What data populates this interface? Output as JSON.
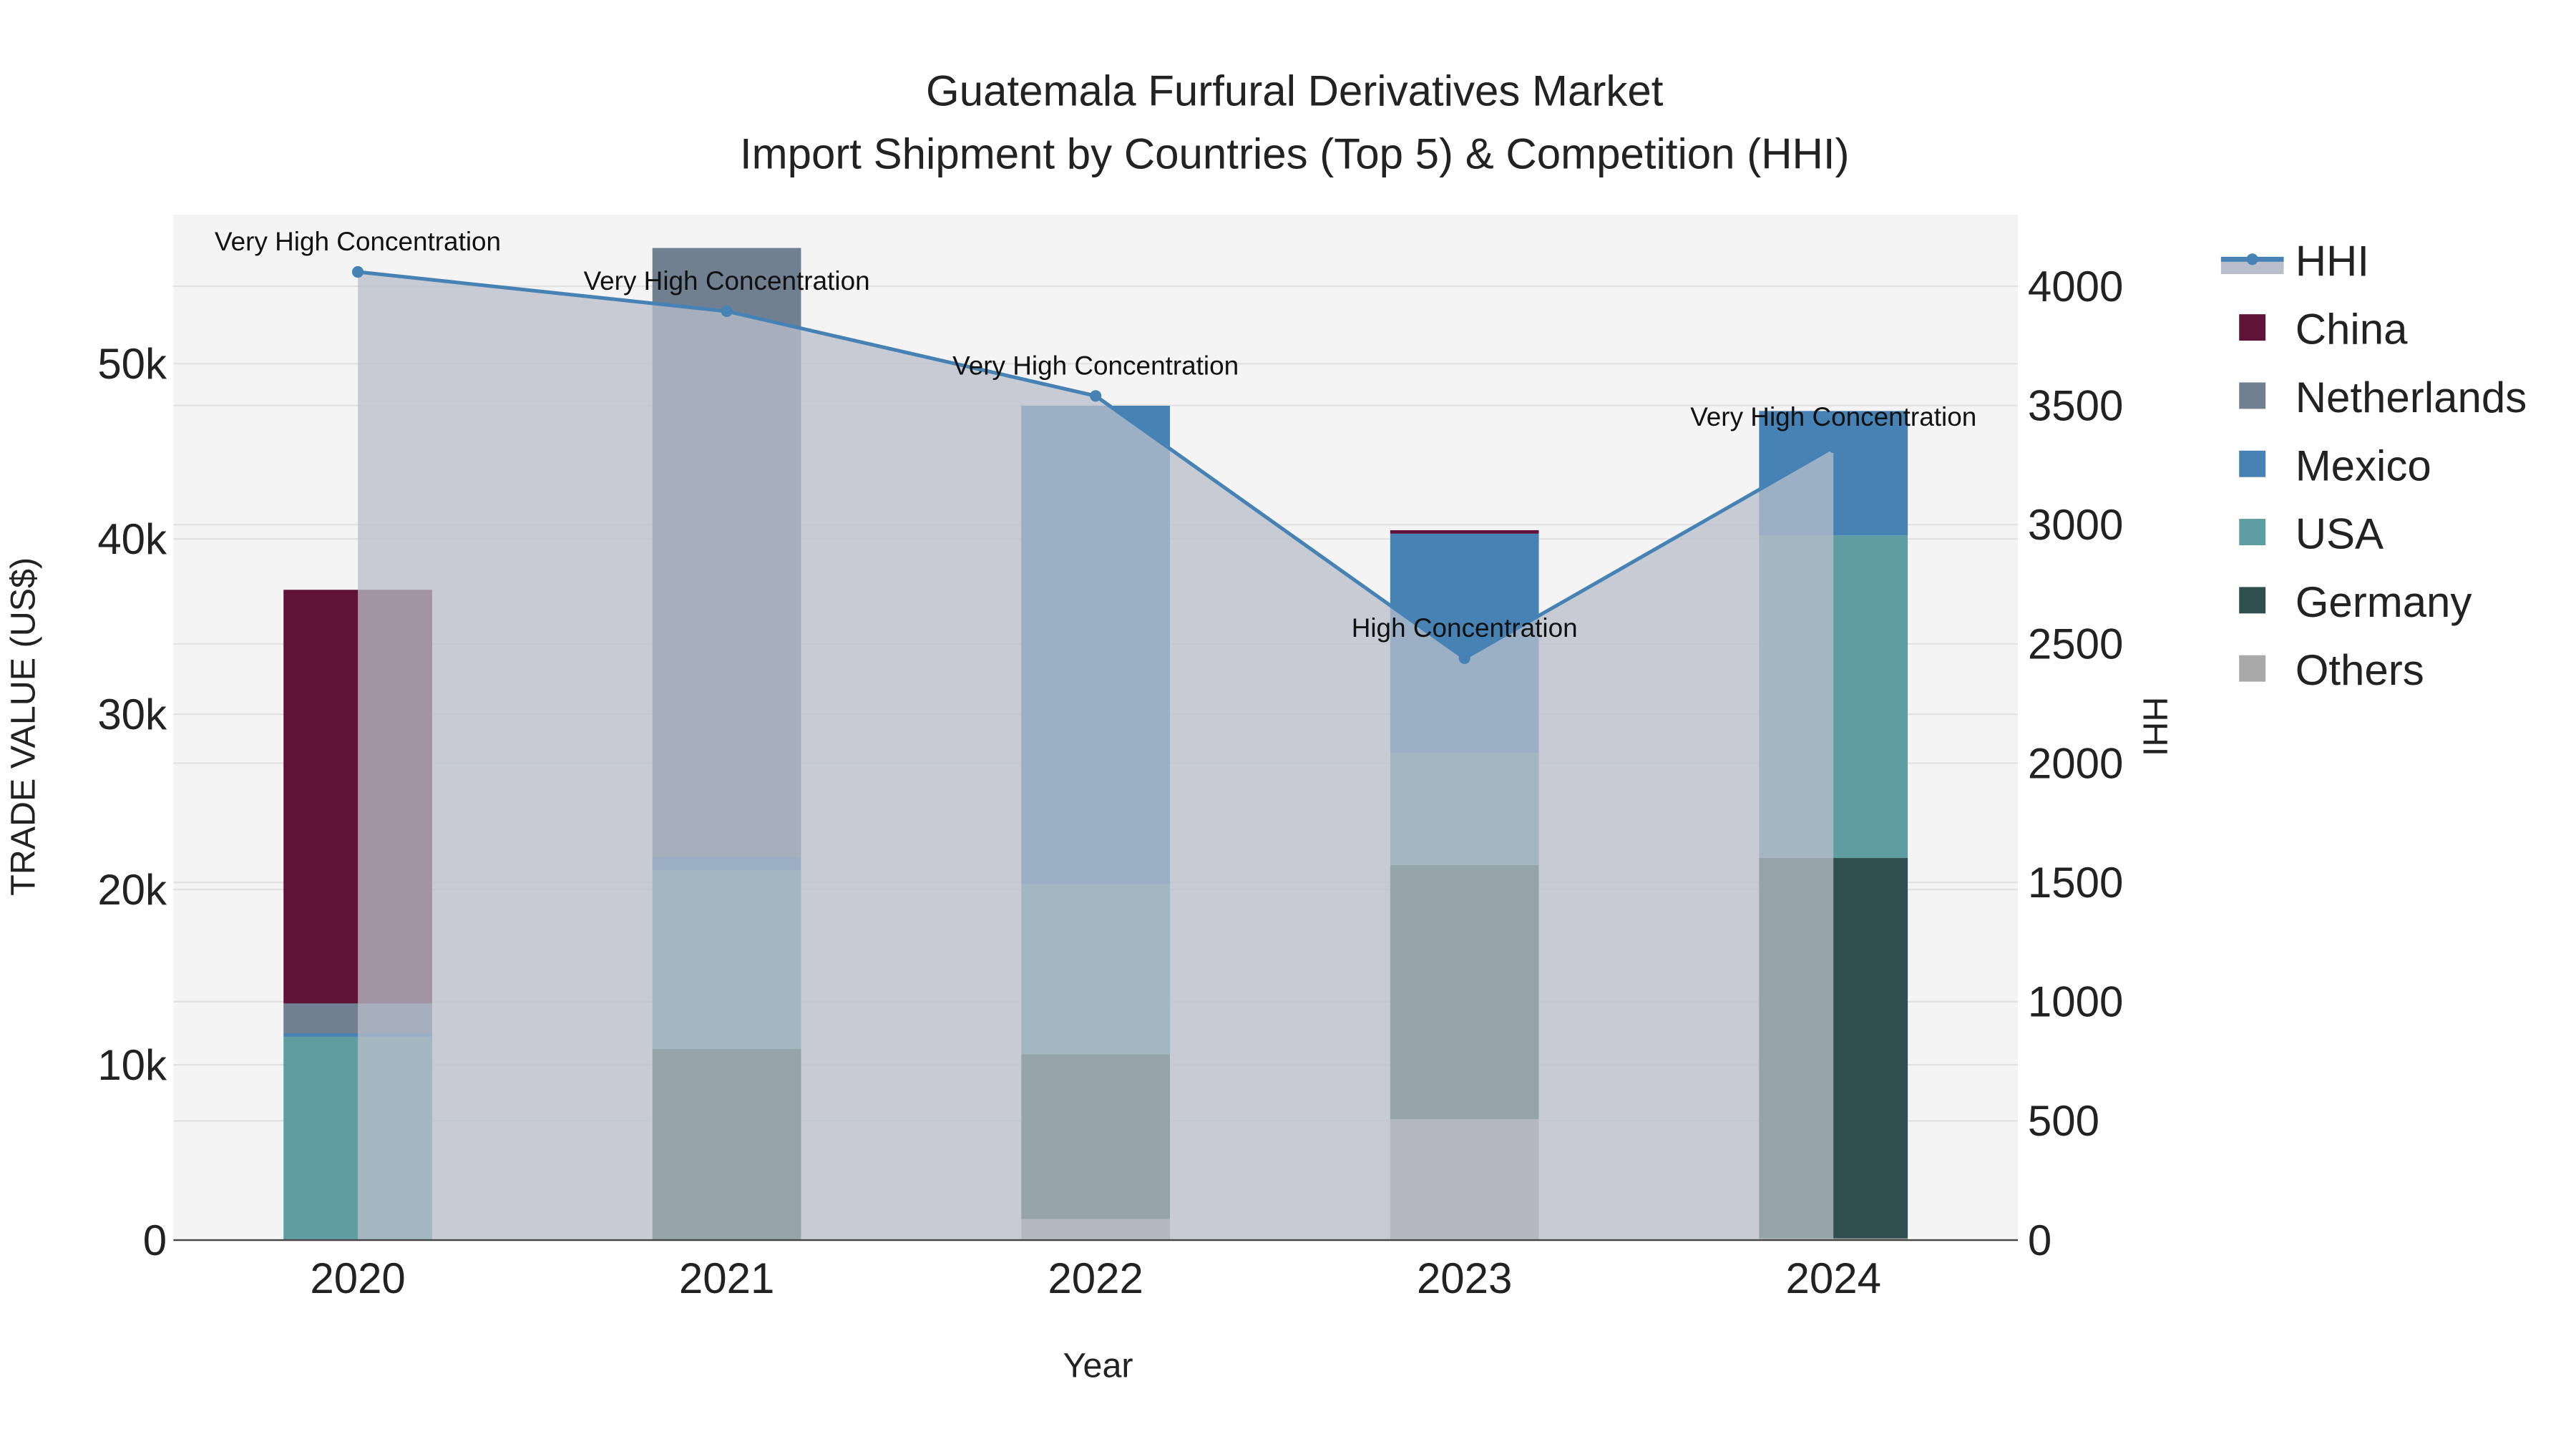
{
  "chart_data": {
    "type": "bar",
    "barmode": "stack",
    "title": "Guatemala Furfural Derivatives Market",
    "subtitle": "Import Shipment by Countries (Top 5) & Competition (HHI)",
    "xlabel": "Year",
    "ylabel": "TRADE VALUE (US$)",
    "y2label": "HHI",
    "categories": [
      "2020",
      "2021",
      "2022",
      "2023",
      "2024"
    ],
    "ylim": [
      0,
      58500
    ],
    "y_ticks": [
      0,
      10000,
      20000,
      30000,
      40000,
      50000
    ],
    "y_tick_labels": [
      "0",
      "10k",
      "20k",
      "30k",
      "40k",
      "50k"
    ],
    "y2lim": [
      0,
      4300
    ],
    "y2_ticks": [
      0,
      500,
      1000,
      1500,
      2000,
      2500,
      3000,
      3500,
      4000
    ],
    "y2_tick_labels": [
      "0",
      "500",
      "1000",
      "1500",
      "2000",
      "2500",
      "3000",
      "3500",
      "4000"
    ],
    "grid": true,
    "legend_position": "right",
    "series": [
      {
        "name": "Others",
        "color": "#a9a9a9",
        "values": [
          0,
          0,
          1200,
          6900,
          100
        ]
      },
      {
        "name": "Germany",
        "color": "#2f4f4f",
        "values": [
          0,
          10900,
          9400,
          14500,
          21700
        ]
      },
      {
        "name": "USA",
        "color": "#5f9ea0",
        "values": [
          11600,
          10200,
          9700,
          6400,
          18400
        ]
      },
      {
        "name": "Mexico",
        "color": "#4682b4",
        "values": [
          200,
          800,
          27300,
          12500,
          7100
        ]
      },
      {
        "name": "Netherlands",
        "color": "#708090",
        "values": [
          1700,
          34700,
          0,
          0,
          0
        ]
      },
      {
        "name": "China",
        "color": "#5f1338",
        "values": [
          23600,
          0,
          0,
          200,
          0
        ]
      }
    ],
    "legend_order": [
      "HHI",
      "China",
      "Netherlands",
      "Mexico",
      "USA",
      "Germany",
      "Others"
    ],
    "hhi": {
      "name": "HHI",
      "color": "#4682b4",
      "values": [
        4060,
        3895,
        3540,
        2440,
        3325
      ],
      "annotations": [
        "Very High Concentration",
        "Very High Concentration",
        "Very High Concentration",
        "High Concentration",
        "Very High Concentration"
      ]
    }
  }
}
